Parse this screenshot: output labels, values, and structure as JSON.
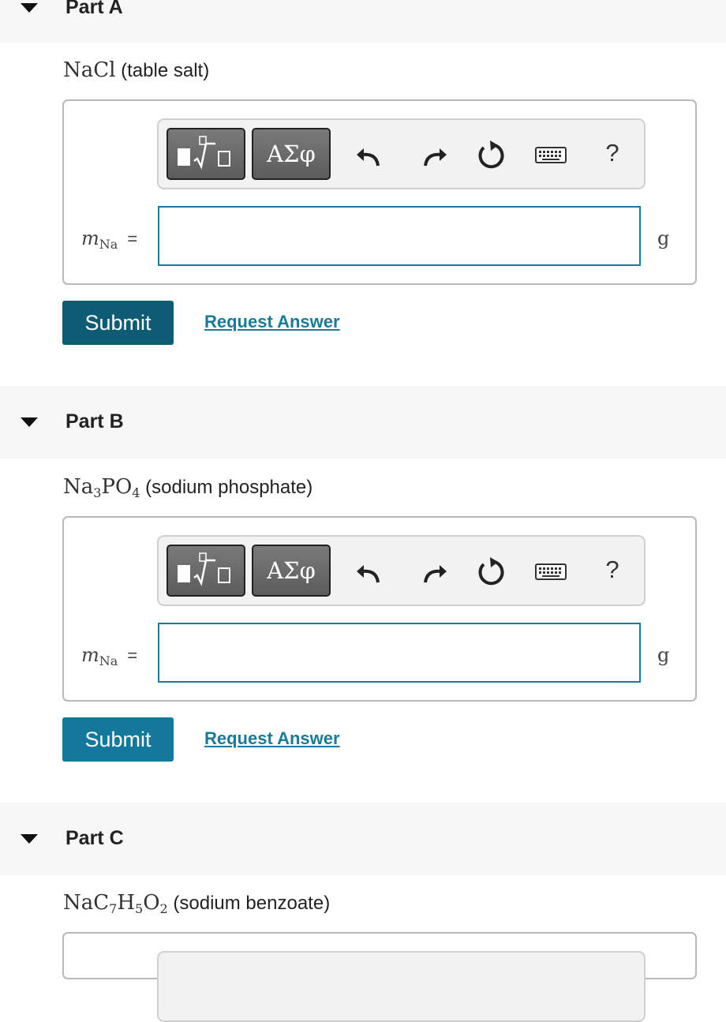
{
  "parts": [
    {
      "title": "Part A",
      "compound": "NaCl",
      "compound_parts": [
        {
          "t": "NaCl",
          "sub": ""
        }
      ],
      "description": "(table salt)",
      "variable": "m",
      "variable_sub": "Na",
      "equals": "=",
      "answer_value": "",
      "unit": "g",
      "submit_label": "Submit",
      "request_label": "Request Answer"
    },
    {
      "title": "Part B",
      "compound_parts": [
        {
          "t": "Na",
          "sub": "3"
        },
        {
          "t": "PO",
          "sub": "4"
        }
      ],
      "description": "(sodium phosphate)",
      "variable": "m",
      "variable_sub": "Na",
      "equals": "=",
      "answer_value": "",
      "unit": "g",
      "submit_label": "Submit",
      "request_label": "Request Answer"
    },
    {
      "title": "Part C",
      "compound_parts": [
        {
          "t": "NaC",
          "sub": "7"
        },
        {
          "t": "H",
          "sub": "5"
        },
        {
          "t": "O",
          "sub": "2"
        }
      ],
      "description": "(sodium benzoate)"
    }
  ],
  "toolbar": {
    "greek_label": "ΑΣφ",
    "help_label": "?",
    "icons": [
      "templates-icon",
      "greek-symbols-button",
      "undo-icon",
      "redo-icon",
      "reset-icon",
      "keyboard-icon",
      "help-icon"
    ]
  },
  "colors": {
    "submit_dark": "#0d5c73",
    "submit_light": "#13789b",
    "link": "#1a7a9a",
    "input_border": "#1a7a9a"
  }
}
